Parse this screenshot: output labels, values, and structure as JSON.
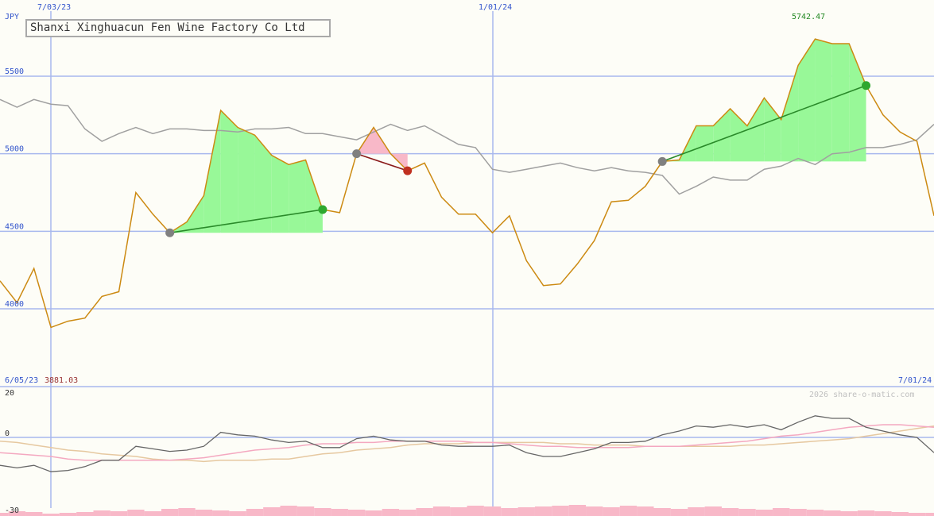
{
  "title": "Shanxi Xinghuacun Fen Wine Factory Co Ltd",
  "currency": "JPY",
  "watermark": "2026 share-o-matic.com",
  "colors": {
    "background": "#fdfdf7",
    "price_line": "#cc8a12",
    "comparison_line": "#a0a0a0",
    "gridline": "#a8b8ee",
    "gain_fill": "#98f898",
    "loss_fill": "#f8b8c8",
    "gain_line": "#2a8a2a",
    "loss_line": "#8a1a1a",
    "axis_text": "#3355cc"
  },
  "chart_data": [
    {
      "type": "line",
      "panel": "price",
      "ylim": [
        3750,
        5950
      ],
      "y_ticks": [
        4000,
        4500,
        5000,
        5500
      ],
      "x_tick_labels": [
        "7/03/23",
        "1/01/24"
      ],
      "range_start_label": "6/05/23",
      "range_end_label": "7/01/24",
      "max_label": "5742.47",
      "min_label": "3881.03",
      "series": [
        {
          "key": "price",
          "values": [
            4180,
            4040,
            4260,
            3880,
            3920,
            3940,
            4080,
            4110,
            4750,
            4610,
            4490,
            4560,
            4730,
            5280,
            5170,
            5120,
            4990,
            4930,
            4960,
            4640,
            4620,
            5000,
            5170,
            5000,
            4890,
            4940,
            4720,
            4610,
            4610,
            4490,
            4600,
            4310,
            4150,
            4160,
            4290,
            4440,
            4690,
            4700,
            4790,
            4950,
            4960,
            5180,
            5180,
            5290,
            5180,
            5360,
            5220,
            5570,
            5740,
            5710,
            5710,
            5440,
            5250,
            5140,
            5080,
            4600
          ]
        },
        {
          "key": "comparison",
          "values": [
            5350,
            5300,
            5350,
            5320,
            5310,
            5160,
            5080,
            5130,
            5170,
            5130,
            5160,
            5160,
            5150,
            5150,
            5140,
            5160,
            5160,
            5170,
            5130,
            5130,
            5110,
            5090,
            5140,
            5190,
            5150,
            5180,
            5120,
            5060,
            5040,
            4900,
            4880,
            4900,
            4920,
            4940,
            4910,
            4890,
            4910,
            4890,
            4880,
            4860,
            4740,
            4790,
            4850,
            4830,
            4830,
            4900,
            4920,
            4970,
            4930,
            5000,
            5010,
            5040,
            5040,
            5060,
            5090,
            5190
          ]
        }
      ],
      "trades": [
        {
          "direction": "gain",
          "start_index": 10,
          "start_value": 4490,
          "end_index": 19,
          "end_value": 4640
        },
        {
          "direction": "loss",
          "start_index": 21,
          "start_value": 5000,
          "end_index": 24,
          "end_value": 4890
        },
        {
          "direction": "gain",
          "start_index": 39,
          "start_value": 4950,
          "end_index": 51,
          "end_value": 5440
        }
      ]
    },
    {
      "type": "line",
      "panel": "oscillator",
      "ylim": [
        -30,
        23
      ],
      "y_ticks": [
        20,
        0,
        -30
      ],
      "series": [
        {
          "key": "momentum",
          "values": [
            -22,
            -24,
            -22,
            -27,
            -26,
            -23,
            -18,
            -18,
            -7,
            -9,
            -11,
            -10,
            -7,
            4,
            2,
            1,
            -2,
            -4,
            -3,
            -8,
            -8,
            -1,
            1,
            -2,
            -3,
            -3,
            -6,
            -7,
            -7,
            -7,
            -6,
            -12,
            -15,
            -15,
            -12,
            -9,
            -4,
            -4,
            -3,
            2,
            5,
            9,
            8,
            10,
            8,
            10,
            6,
            12,
            17,
            15,
            15,
            8,
            5,
            2,
            0,
            -12
          ]
        },
        {
          "key": "fast_average",
          "values": [
            -12,
            -13,
            -14,
            -15,
            -17,
            -18,
            -18,
            -18,
            -18,
            -18,
            -18,
            -17,
            -16,
            -14,
            -12,
            -10,
            -9,
            -8,
            -6,
            -5,
            -5,
            -4,
            -4,
            -3,
            -3,
            -3,
            -3,
            -3,
            -4,
            -4,
            -5,
            -6,
            -7,
            -7,
            -8,
            -8,
            -8,
            -8,
            -7,
            -7,
            -7,
            -6,
            -5,
            -4,
            -3,
            -1,
            1,
            2,
            4,
            6,
            8,
            9,
            10,
            10,
            9,
            8
          ]
        },
        {
          "key": "slow_average",
          "values": [
            -3,
            -4,
            -6,
            -8,
            -10,
            -11,
            -13,
            -14,
            -15,
            -17,
            -18,
            -18,
            -19,
            -18,
            -18,
            -18,
            -17,
            -17,
            -15,
            -13,
            -12,
            -10,
            -9,
            -8,
            -6,
            -5,
            -5,
            -5,
            -4,
            -4,
            -4,
            -4,
            -4,
            -5,
            -5,
            -6,
            -6,
            -6,
            -7,
            -7,
            -7,
            -7,
            -7,
            -7,
            -6,
            -6,
            -5,
            -4,
            -3,
            -2,
            -1,
            1,
            3,
            5,
            7,
            9
          ]
        }
      ]
    }
  ]
}
